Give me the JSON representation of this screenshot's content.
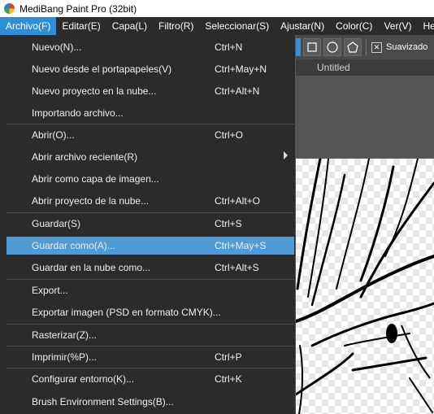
{
  "app": {
    "title": "MediBang Paint Pro (32bit)"
  },
  "menubar": {
    "items": [
      "Archivo(F)",
      "Editar(E)",
      "Capa(L)",
      "Filtro(R)",
      "Seleccionar(S)",
      "Ajustar(N)",
      "Color(C)",
      "Ver(V)",
      "He"
    ]
  },
  "toolbar": {
    "smooth_label": "Suavizado",
    "smooth_checked": "✕"
  },
  "tab": {
    "label": "Untitled"
  },
  "file_menu": {
    "items": [
      {
        "label": "Nuevo(N)...",
        "shortcut": "Ctrl+N"
      },
      {
        "label": "Nuevo desde el portapapeles(V)",
        "shortcut": "Ctrl+May+N"
      },
      {
        "label": "Nuevo proyecto en la nube...",
        "shortcut": "Ctrl+Alt+N"
      },
      {
        "label": "Importando archivo...",
        "shortcut": ""
      },
      {
        "label": "Abrir(O)...",
        "shortcut": "Ctrl+O"
      },
      {
        "label": "Abrir archivo reciente(R)",
        "shortcut": ""
      },
      {
        "label": "Abrir como capa de imagen...",
        "shortcut": ""
      },
      {
        "label": "Abrir proyecto de la nube...",
        "shortcut": "Ctrl+Alt+O"
      },
      {
        "label": "Guardar(S)",
        "shortcut": "Ctrl+S"
      },
      {
        "label": "Guardar como(A)...",
        "shortcut": "Ctrl+May+S"
      },
      {
        "label": "Guardar en la nube como...",
        "shortcut": "Ctrl+Alt+S"
      },
      {
        "label": "Export...",
        "shortcut": ""
      },
      {
        "label": "Exportar imagen (PSD en formato CMYK)...",
        "shortcut": ""
      },
      {
        "label": "Rasterizar(Z)...",
        "shortcut": ""
      },
      {
        "label": "Imprimir(%P)...",
        "shortcut": "Ctrl+P"
      },
      {
        "label": "Configurar entorno(K)...",
        "shortcut": "Ctrl+K"
      },
      {
        "label": "Brush Environment Settings(B)...",
        "shortcut": ""
      }
    ]
  },
  "colors": {
    "menu_bg": "#2b2b2b",
    "highlight": "#4e9bd6",
    "active_menu": "#2f8fd6"
  }
}
